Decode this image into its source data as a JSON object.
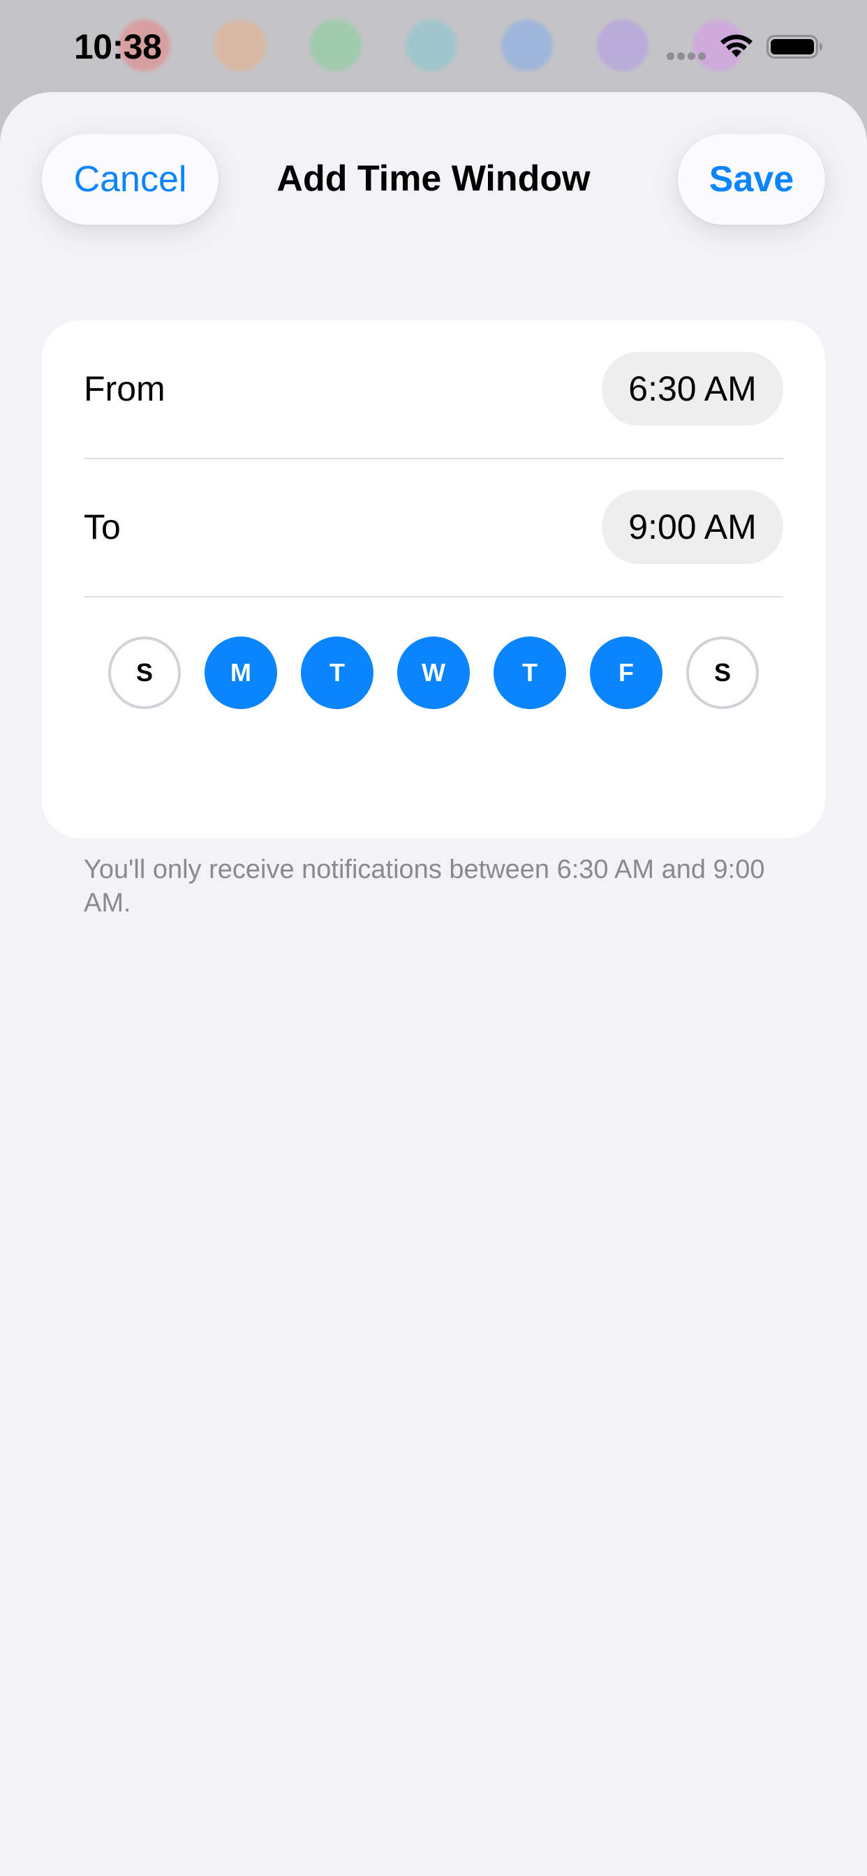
{
  "status_bar": {
    "time": "10:38",
    "icons": [
      "cellular-dots-icon",
      "wifi-icon",
      "battery-icon"
    ]
  },
  "background": {
    "dot_colors": [
      "#ff5b5b",
      "#ffa35b",
      "#5bd67a",
      "#5bc8d6",
      "#5b9bff",
      "#a77bff",
      "#e07bff"
    ]
  },
  "header": {
    "title": "Add Time Window",
    "cancel_label": "Cancel",
    "save_label": "Save"
  },
  "time_window": {
    "from_label": "From",
    "from_value": "6:30 AM",
    "to_label": "To",
    "to_value": "9:00 AM"
  },
  "days": [
    {
      "label": "S",
      "selected": false
    },
    {
      "label": "M",
      "selected": true
    },
    {
      "label": "T",
      "selected": true
    },
    {
      "label": "W",
      "selected": true
    },
    {
      "label": "T",
      "selected": true
    },
    {
      "label": "F",
      "selected": true
    },
    {
      "label": "S",
      "selected": false
    }
  ],
  "footnote": "You'll only receive notifications between 6:30 AM and 9:00 AM.",
  "colors": {
    "accent": "#0a84ff",
    "background": "#f2f2f7",
    "card": "#ffffff",
    "secondary_text": "#8a8a8e"
  }
}
